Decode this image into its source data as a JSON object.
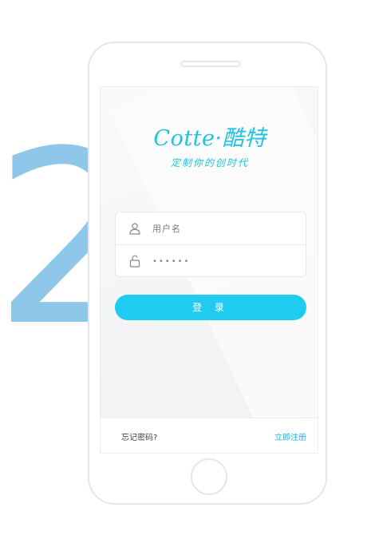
{
  "step": {
    "number": "2"
  },
  "brand": {
    "title": "Cotte·酷特",
    "slogan": "定制你的创时代",
    "accent_color": "#22c2dd"
  },
  "login_form": {
    "username_placeholder": "用户名",
    "password_value": "••••••",
    "username_icon": "user-icon",
    "password_icon": "lock-icon",
    "submit_label": "登 录",
    "button_color": "#20cbf2"
  },
  "footer": {
    "forgot_label": "忘记密码?",
    "register_label": "立即注册"
  },
  "colors": {
    "step_number": "#8ec7ea",
    "phone_frame": "#e4e6e8"
  }
}
